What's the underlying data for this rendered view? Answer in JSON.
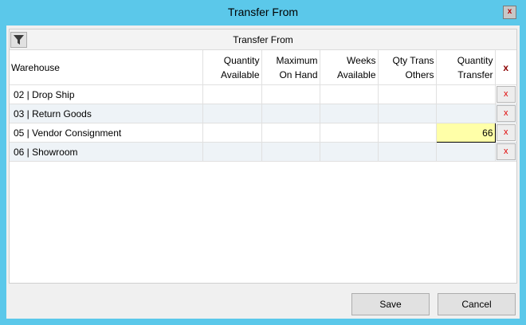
{
  "window": {
    "title": "Transfer From",
    "close_label": "x"
  },
  "grid": {
    "title": "Transfer From",
    "columns": {
      "warehouse": "Warehouse",
      "qty_available_1": "Quantity",
      "qty_available_2": "Available",
      "max_on_hand_1": "Maximum",
      "max_on_hand_2": "On Hand",
      "weeks_available_1": "Weeks",
      "weeks_available_2": "Available",
      "qty_trans_others_1": "Qty Trans",
      "qty_trans_others_2": "Others",
      "qty_transfer_1": "Quantity",
      "qty_transfer_2": "Transfer",
      "remove_all": "x"
    },
    "rows": [
      {
        "warehouse": "02 | Drop Ship",
        "qty_transfer": "",
        "remove": "x"
      },
      {
        "warehouse": "03 | Return Goods",
        "qty_transfer": "",
        "remove": "x"
      },
      {
        "warehouse": "05 | Vendor Consignment",
        "qty_transfer": "66",
        "remove": "x"
      },
      {
        "warehouse": "06 | Showroom",
        "qty_transfer": "",
        "remove": "x"
      }
    ]
  },
  "footer": {
    "save_label": "Save",
    "cancel_label": "Cancel"
  },
  "colors": {
    "title_bar": "#5bc8ea",
    "active_cell": "#ffffa8",
    "remove_x": "#e00000"
  },
  "icons": {
    "filter": "filter-icon"
  }
}
